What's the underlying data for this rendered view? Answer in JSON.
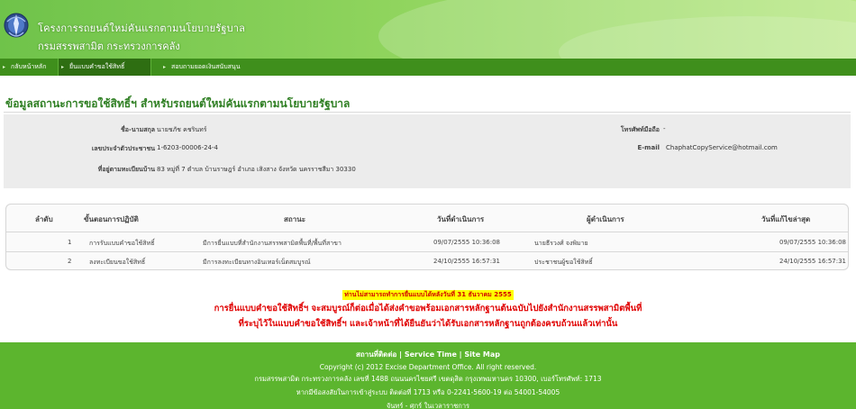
{
  "header": {
    "title_line1": "โครงการรถยนต์ใหม่คันแรกตามนโยบายรัฐบาล",
    "title_line2": "กรมสรรพสามิต กระทรวงการคลัง"
  },
  "nav": {
    "items": [
      {
        "label": "กลับหน้าหลัก"
      },
      {
        "label": "ยื่นแบบคำขอใช้สิทธิ์"
      },
      {
        "label": "สอบถามยอดเงินสนับสนุน"
      }
    ]
  },
  "section": {
    "title": "ข้อมูลสถานะการขอใช้สิทธิ์ฯ สำหรับรถยนต์ใหม่คันแรกตามนโยบายรัฐบาล"
  },
  "info": {
    "name_label": "ชื่อ-นามสกุล",
    "name_value": "นายชภัช คชรินทร์",
    "id_label": "เลขประจำตัวประชาชน",
    "id_value": "1-6203-00006-24-4",
    "address_label": "ที่อยู่ตามทะเบียนบ้าน",
    "address_value": "83 หมู่ที่ 7 ตำบล บ้านราษฎร์ อำเภอ เสิงสาง จังหวัด นครราชสีมา 30330",
    "mobile_label": "โทรศัพท์มือถือ",
    "mobile_value": "-",
    "email_label": "E-mail",
    "email_value": "ChaphatCopyService@hotmail.com"
  },
  "table": {
    "headers": [
      "ลำดับ",
      "ขั้นตอนการปฏิบัติ",
      "สถานะ",
      "วันที่ดำเนินการ",
      "ผู้ดำเนินการ",
      "วันที่แก้ไขล่าสุด"
    ],
    "rows": [
      {
        "no": "1",
        "step": "การรับแบบคำขอใช้สิทธิ์",
        "status": "มีการยื่นแบบที่สำนักงานสรรพสามิตพื้นที่/พื้นที่สาขา",
        "date": "09/07/2555 10:36:08",
        "operator": "นายธีรวงศ์ จงพิมาย",
        "updated": "09/07/2555 10:36:08"
      },
      {
        "no": "2",
        "step": "ลงทะเบียนขอใช้สิทธิ์",
        "status": "มีการลงทะเบียนทางอินเทอร์เน็ตสมบูรณ์",
        "date": "24/10/2555 16:57:31",
        "operator": "ประชาชนผู้ขอใช้สิทธิ์",
        "updated": "24/10/2555 16:57:31"
      }
    ]
  },
  "notice": {
    "highlight": "ท่านไม่สามารถทำการยื่นแบบได้หลังวันที่ 31 ธันวาคม 2555",
    "line1": "การยื่นแบบคำขอใช้สิทธิ์ฯ จะสมบูรณ์ก็ต่อเมื่อได้ส่งคำขอพร้อมเอกสารหลักฐานต้นฉบับไปยังสำนักงานสรรพสามิตพื้นที่",
    "line2": "ที่ระบุไว้ในแบบคำขอใช้สิทธิ์ฯ และเจ้าหน้าที่ได้ยืนยันว่าได้รับเอกสารหลักฐานถูกต้องครบถ้วนแล้วเท่านั้น"
  },
  "footer": {
    "link_contact": "สถานที่ติดต่อ",
    "link_service": "Service Time",
    "link_sitemap": "Site Map",
    "sep": "|",
    "copyright": "Copyright (c) 2012 Excise Department Office. All right reserved.",
    "address": "กรมสรรพสามิต กระทรวงการคลัง เลขที่ 1488 ถนนนครไชยศรี เขตดุสิต กรุงเทพมหานคร 10300, เบอร์โทรศัพท์: 1713",
    "contact": "หากมีข้อสงสัยในการเข้าสู่ระบบ ติดต่อที่ 1713 หรือ 0-2241-5600-19 ต่อ 54001-54005",
    "hours": "จันทร์ - ศุกร์ ในเวลาราชการ"
  },
  "colors": {
    "header_green": "#6fc34a",
    "nav_green": "#3f8f1c",
    "title_green": "#2f7f23",
    "footer_green": "#5cb52e",
    "notice_red": "#e00000",
    "highlight_yellow": "#ffff00"
  },
  "icons": {
    "logo": "excise-department-emblem",
    "nav_arrow": "arrow-right-icon"
  }
}
